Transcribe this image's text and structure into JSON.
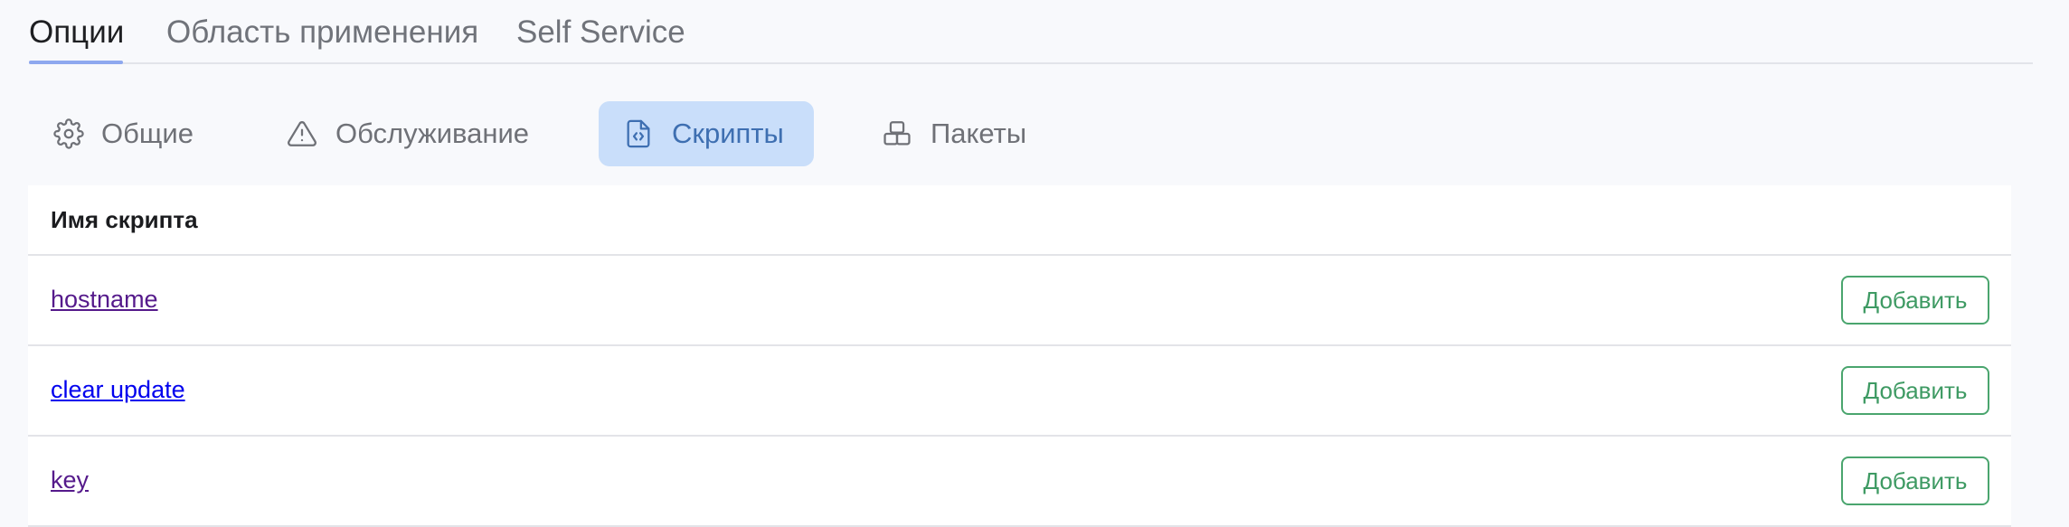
{
  "top_tabs": [
    {
      "label": "Опции",
      "active": true
    },
    {
      "label": "Область применения",
      "active": false
    },
    {
      "label": "Self Service",
      "active": false
    }
  ],
  "sub_tabs": [
    {
      "label": "Общие",
      "icon": "gear-icon",
      "active": false
    },
    {
      "label": "Обслуживание",
      "icon": "warning-triangle-icon",
      "active": false
    },
    {
      "label": "Скрипты",
      "icon": "script-file-icon",
      "active": true
    },
    {
      "label": "Пакеты",
      "icon": "package-icon",
      "active": false
    }
  ],
  "table": {
    "header": "Имя скрипта",
    "rows": [
      {
        "name": "hostname",
        "link_color": "#551a8b",
        "action": "Добавить"
      },
      {
        "name": "clear update",
        "link_color": "#0000ee",
        "action": "Добавить"
      },
      {
        "name": "key",
        "link_color": "#551a8b",
        "action": "Добавить"
      }
    ]
  },
  "colors": {
    "page_background": "#f8f9fc",
    "active_tab_underline": "#8ea8ef",
    "active_subtab_background": "#c9defa",
    "active_subtab_text": "#3e6fb1",
    "button_border": "#4aa56e",
    "button_text": "#3e9a63"
  }
}
